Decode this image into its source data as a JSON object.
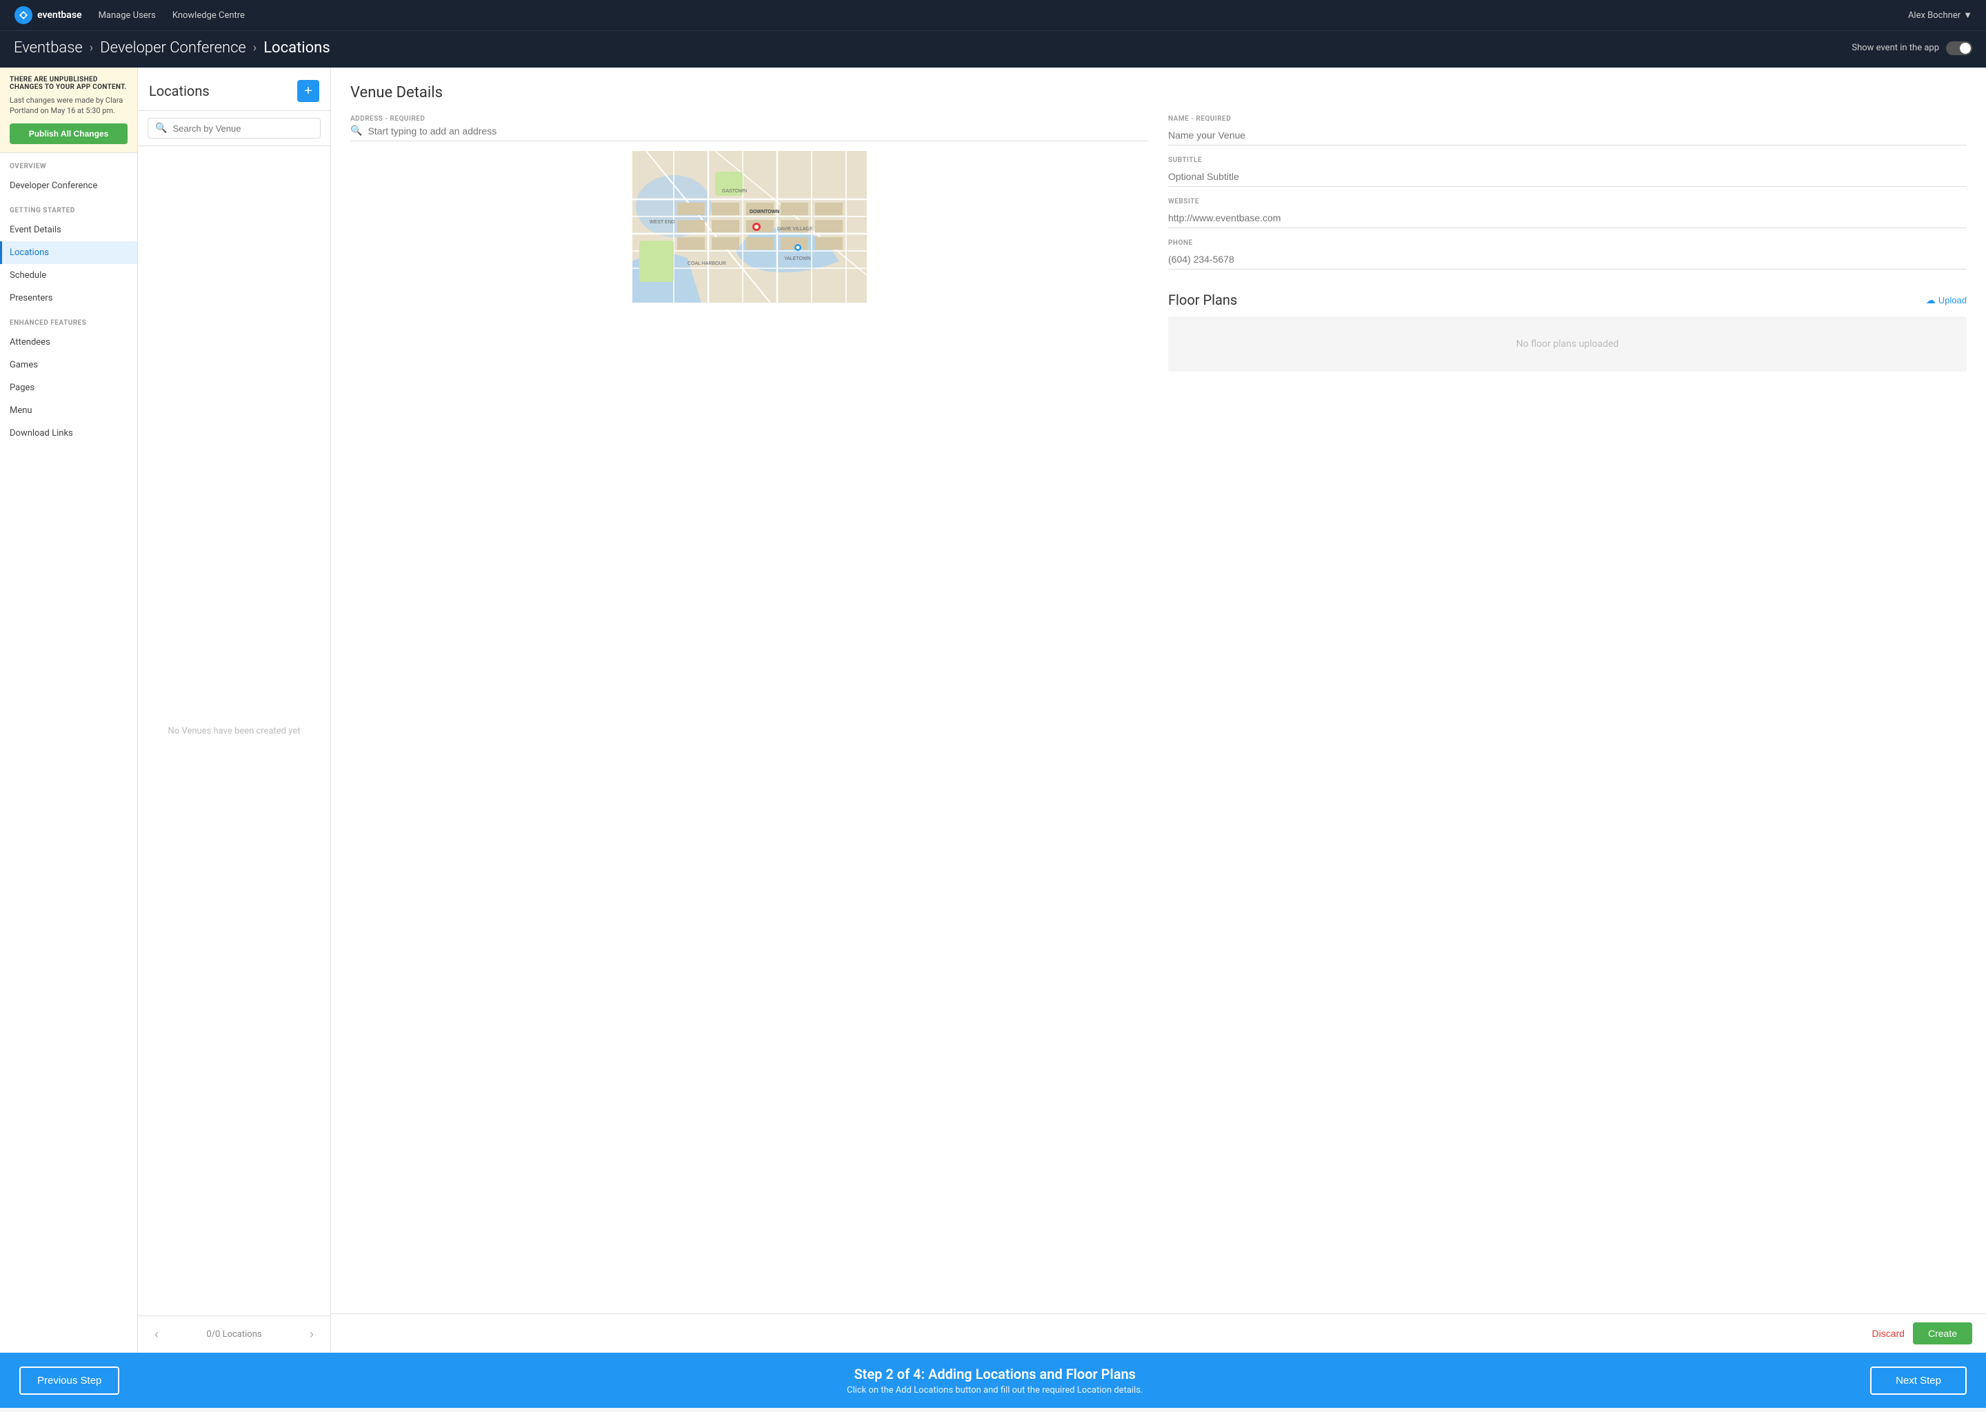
{
  "topNav": {
    "logo": "eventbase",
    "links": [
      "Manage Users",
      "Knowledge Centre"
    ],
    "user": "Alex Bochner"
  },
  "breadcrumb": {
    "items": [
      "Eventbase",
      "Developer Conference",
      "Locations"
    ],
    "showEventLabel": "Show event in the app"
  },
  "sidebar": {
    "alert": {
      "title": "THERE ARE UNPUBLISHED CHANGES TO YOUR APP CONTENT.",
      "text": "Last changes were made by Clara Portland on May 16 at 5:30 pm.",
      "publishBtn": "Publish All Changes"
    },
    "sections": [
      {
        "label": "OVERVIEW",
        "items": [
          {
            "label": "Developer Conference",
            "active": false
          }
        ]
      },
      {
        "label": "GETTING STARTED",
        "items": [
          {
            "label": "Event Details",
            "active": false
          },
          {
            "label": "Locations",
            "active": true
          }
        ]
      },
      {
        "label": null,
        "items": [
          {
            "label": "Schedule",
            "active": false
          },
          {
            "label": "Presenters",
            "active": false
          }
        ]
      },
      {
        "label": "ENHANCED FEATURES",
        "items": [
          {
            "label": "Attendees",
            "active": false
          },
          {
            "label": "Games",
            "active": false
          },
          {
            "label": "Pages",
            "active": false
          },
          {
            "label": "Menu",
            "active": false
          },
          {
            "label": "Download Links",
            "active": false
          }
        ]
      }
    ]
  },
  "locationsPanel": {
    "title": "Locations",
    "addBtn": "+",
    "searchPlaceholder": "Search by Venue",
    "emptyText": "No Venues have been created yet",
    "count": "0/0 Locations",
    "prevBtn": "‹",
    "nextBtn": "›"
  },
  "venueDetails": {
    "title": "Venue Details",
    "addressLabel": "ADDRESS - REQUIRED",
    "addressPlaceholder": "Start typing to add an address",
    "nameLabel": "NAME - REQUIRED",
    "namePlaceholder": "Name your Venue",
    "subtitleLabel": "SUBTITLE",
    "subtitlePlaceholder": "Optional Subtitle",
    "websiteLabel": "WEBSITE",
    "websitePlaceholder": "http://www.eventbase.com",
    "phoneLabel": "PHONE",
    "phonePlaceholder": "(604) 234-5678",
    "floorPlans": {
      "title": "Floor Plans",
      "uploadBtn": "Upload",
      "emptyText": "No floor plans uploaded"
    }
  },
  "actions": {
    "discard": "Discard",
    "create": "Create"
  },
  "stepBar": {
    "prevBtn": "Previous Step",
    "nextBtn": "Next Step",
    "title": "Step 2 of 4: Adding Locations and Floor Plans",
    "subtitle": "Click on the Add Locations button and fill out the required Location details."
  }
}
